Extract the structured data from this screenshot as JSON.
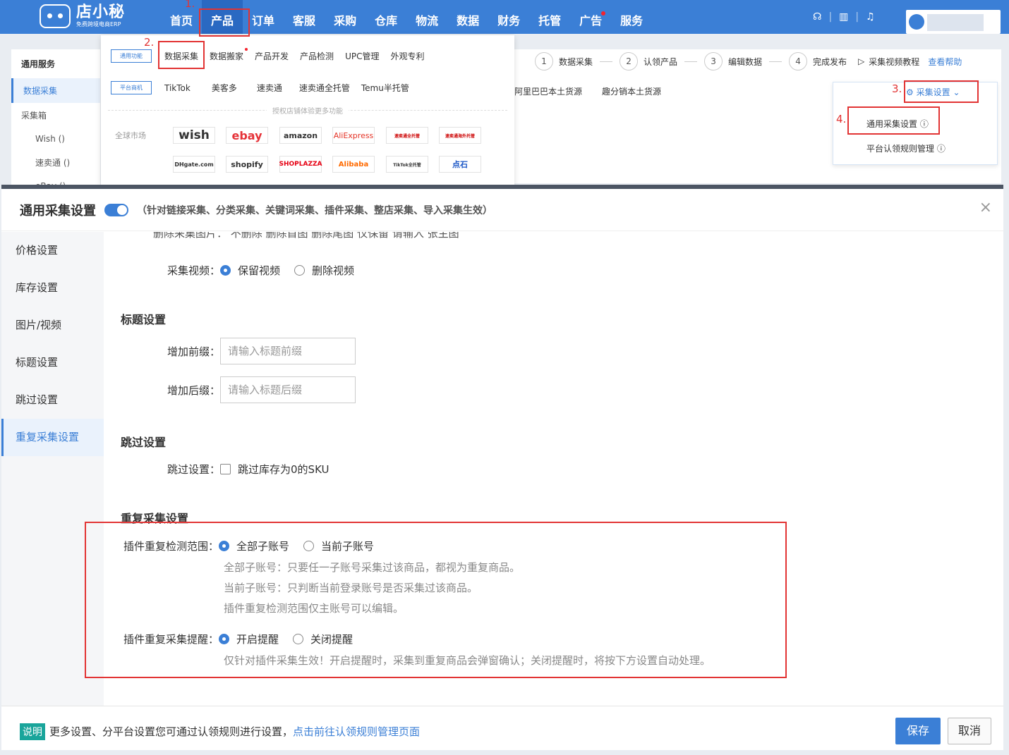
{
  "app": {
    "logo_name": "店小秘",
    "logo_sub": "免费跨境电商ERP"
  },
  "nav": [
    "首页",
    "产品",
    "订单",
    "客服",
    "采购",
    "仓库",
    "物流",
    "数据",
    "财务",
    "托管",
    "广告",
    "服务"
  ],
  "top_sep": "|",
  "left_panel": {
    "title": "通用服务",
    "active": "数据采集",
    "item": "采集箱",
    "subs": [
      "Wish ()",
      "速卖通 ()",
      "eBay ()"
    ]
  },
  "dropdown": {
    "tag1": "通用功能",
    "row1": [
      "数据采集",
      "数据搬家",
      "产品开发",
      "产品检测",
      "UPC管理",
      "外观专利"
    ],
    "tag2": "平台商机",
    "row2": [
      "TikTok",
      "美客多",
      "速卖通",
      "速卖通全托管",
      "Temu半托管"
    ],
    "divider": "授权店铺体验更多功能",
    "market_label": "全球市场",
    "markets": [
      "wish",
      "ebay",
      "amazon",
      "AliExpress",
      "速卖通全托管",
      "速卖通海外托管",
      "DHgate.com",
      "shopify",
      "SHOPLAZZA",
      "Alibaba",
      "TikTok全托管",
      "点石"
    ]
  },
  "steps": [
    {
      "num": "1",
      "label": "数据采集"
    },
    {
      "num": "2",
      "label": "认领产品"
    },
    {
      "num": "3",
      "label": "编辑数据"
    },
    {
      "num": "4",
      "label": "完成发布"
    }
  ],
  "tutorial": "采集视频教程",
  "help": "查看帮助",
  "sources": [
    "阿里巴巴本土货源",
    "趣分销本土货源"
  ],
  "config": {
    "button": "采集设置",
    "item1": "通用采集设置",
    "item2": "平台认领规则管理"
  },
  "annotations": [
    "1.",
    "2.",
    "3.",
    "4."
  ],
  "modal": {
    "title": "通用采集设置",
    "desc": "（针对链接采集、分类采集、关键词采集、插件采集、整店采集、导入采集生效）",
    "close": "×",
    "side": [
      "价格设置",
      "库存设置",
      "图片/视频",
      "标题设置",
      "跳过设置",
      "重复采集设置"
    ],
    "cropped_row": "删除采集图片：  不删除    删除首图    删除尾图    仅保留  请输入  张主图",
    "video_label": "采集视频：",
    "video_opts": [
      "保留视频",
      "删除视频"
    ],
    "title_section": "标题设置",
    "prefix_label": "增加前缀：",
    "prefix_ph": "请输入标题前缀",
    "suffix_label": "增加后缀：",
    "suffix_ph": "请输入标题后缀",
    "skip_section": "跳过设置",
    "skip_label": "跳过设置：",
    "skip_opt": "跳过库存为0的SKU",
    "dup_section": "重复采集设置",
    "dup_scope_label": "插件重复检测范围：",
    "dup_scope_opts": [
      "全部子账号",
      "当前子账号"
    ],
    "dup_hints": [
      "全部子账号：只要任一子账号采集过该商品，都视为重复商品。",
      "当前子账号：只判断当前登录账号是否采集过该商品。",
      "插件重复检测范围仅主账号可以编辑。"
    ],
    "dup_remind_label": "插件重复采集提醒：",
    "dup_remind_opts": [
      "开启提醒",
      "关闭提醒"
    ],
    "dup_remind_hint": "仅针对插件采集生效！开启提醒时，采集到重复商品会弹窗确认；关闭提醒时，将按下方设置自动处理。"
  },
  "footer": {
    "tag": "说明",
    "text": "更多设置、分平台设置您可通过认领规则进行设置，",
    "link": "点击前往认领规则管理页面",
    "save": "保存",
    "cancel": "取消"
  }
}
